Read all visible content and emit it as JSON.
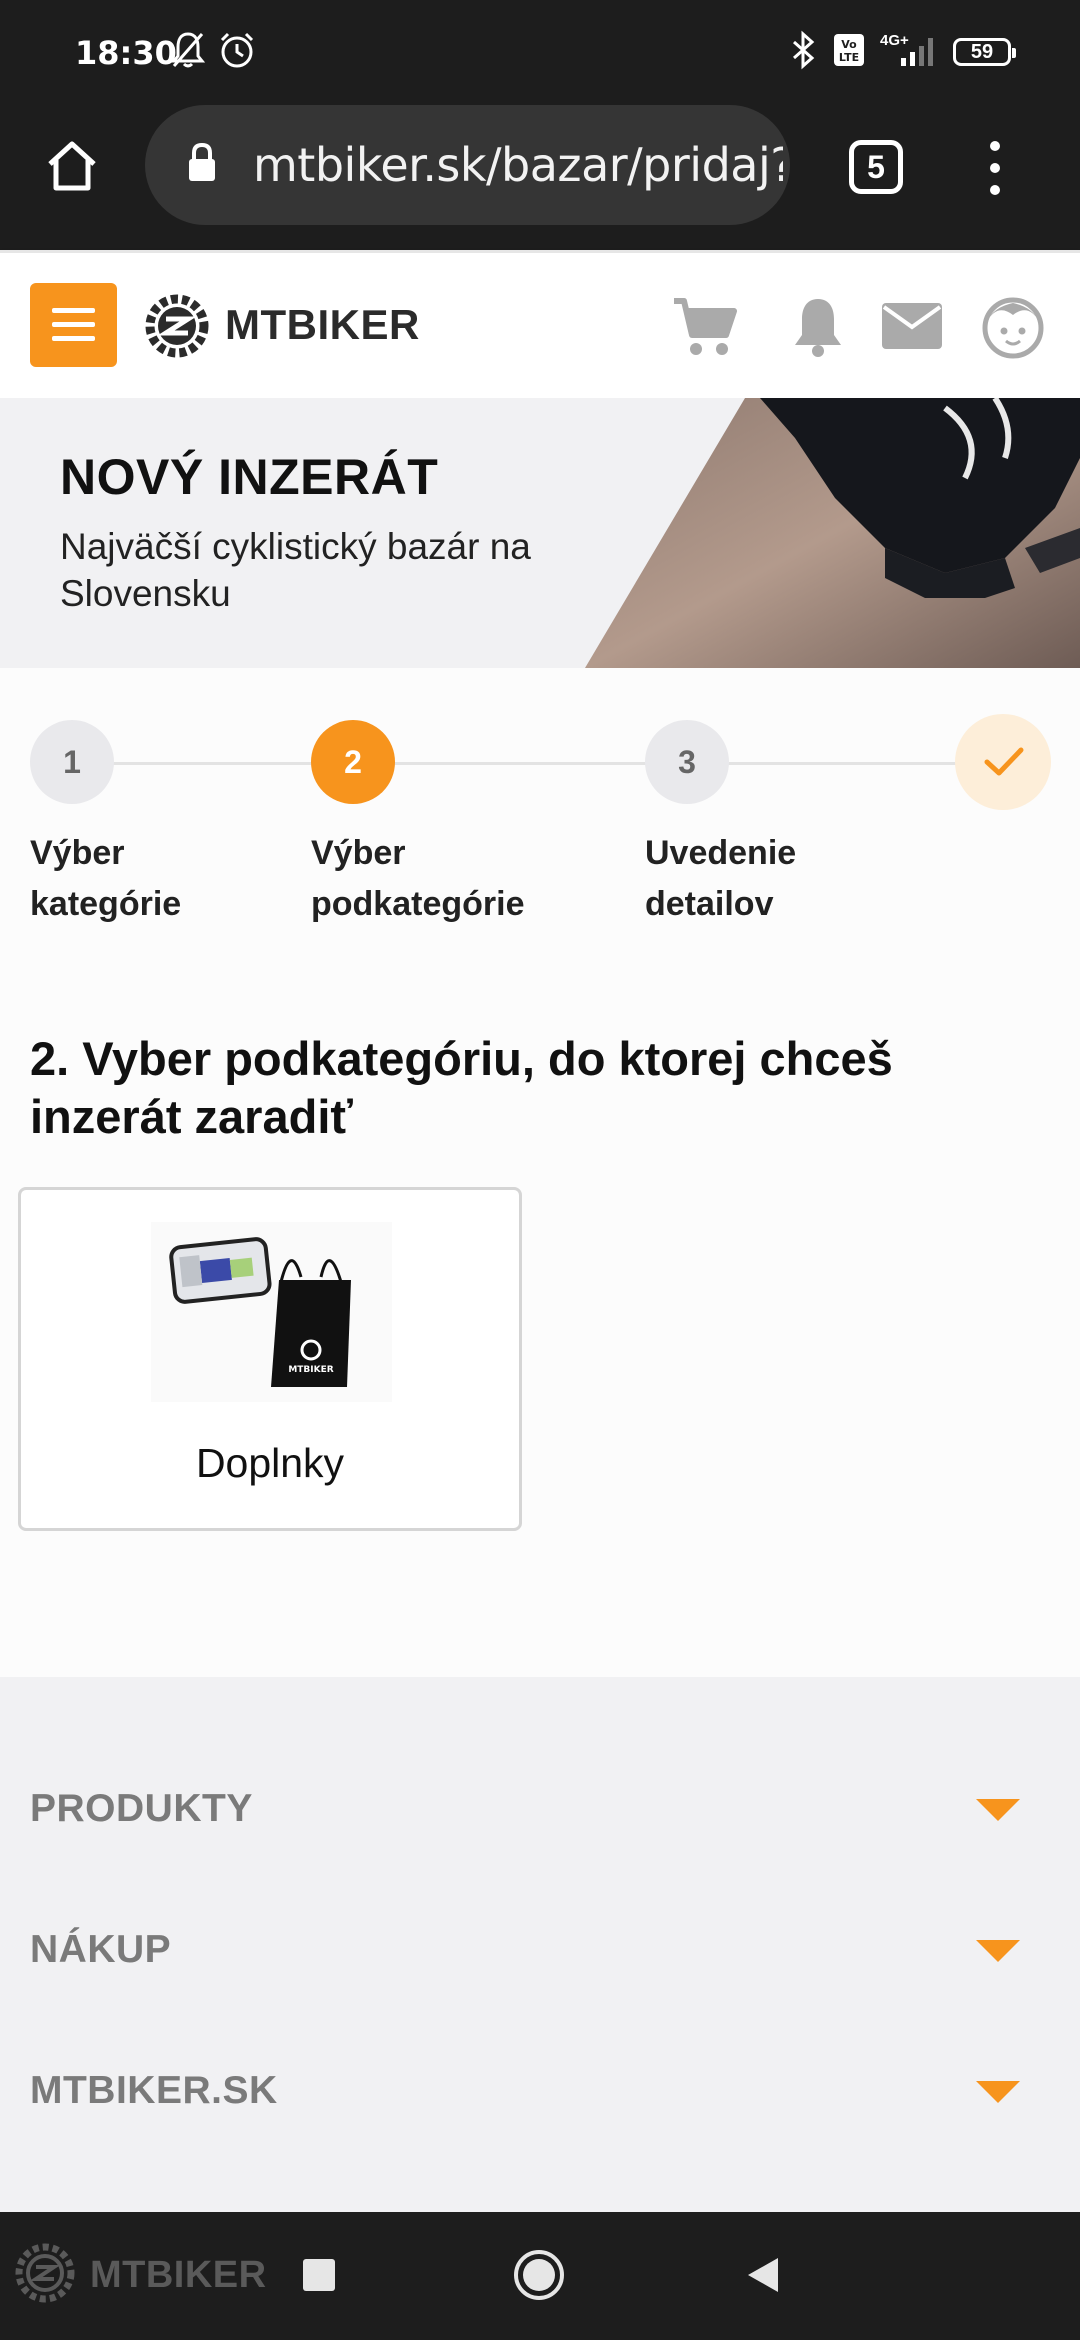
{
  "status_bar": {
    "time": "18:30",
    "network": "4G+",
    "battery": "59"
  },
  "browser": {
    "url": "mtbiker.sk/bazar/pridaj?",
    "tab_count": "5"
  },
  "site": {
    "logo_text": "MTBIKER",
    "accent_color": "#f7941d"
  },
  "hero": {
    "title": "NOVÝ INZERÁT",
    "subtitle": "Najväčší cyklistický bazár na Slovensku"
  },
  "steps": [
    {
      "number": "1",
      "label_line1": "Výber",
      "label_line2": "kategórie",
      "state": "done"
    },
    {
      "number": "2",
      "label_line1": "Výber",
      "label_line2": "podkategórie",
      "state": "active"
    },
    {
      "number": "3",
      "label_line1": "Uvedenie",
      "label_line2": "detailov",
      "state": "pending"
    },
    {
      "number": "",
      "label_line1": "",
      "label_line2": "",
      "state": "final",
      "icon": "check-icon"
    }
  ],
  "section_title": "2. Vyber podkategóriu, do ktorej chceš inzerát zaradiť",
  "subcategories": [
    {
      "label": "Doplnky",
      "image": "bag-and-drawstring-sack"
    }
  ],
  "footer": {
    "items": [
      {
        "label": "PRODUKTY"
      },
      {
        "label": "NÁKUP"
      },
      {
        "label": "MTBIKER.SK"
      }
    ]
  },
  "nav_watermark": "MTBIKER"
}
